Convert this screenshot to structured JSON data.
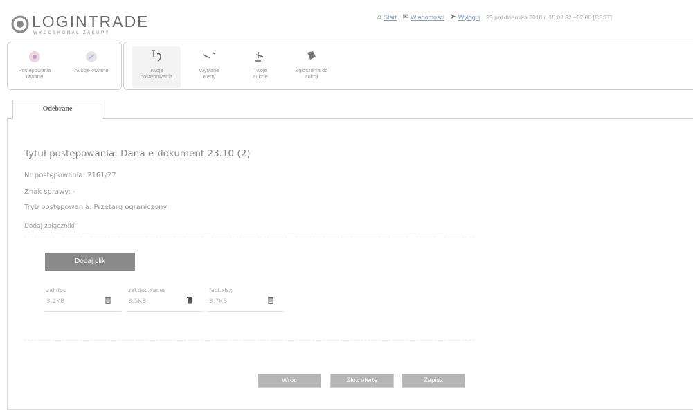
{
  "header": {
    "logo_text": "LOGINTRADE",
    "logo_subtext": "WYDOSKONAL ZAKUPY",
    "nav": [
      {
        "icon": "home-icon",
        "label": "Start"
      },
      {
        "icon": "messages-icon",
        "label": "Wiadomości"
      },
      {
        "icon": "logout-icon",
        "label": "Wyloguj"
      }
    ],
    "timestamp": "25 października 2018 r. 15:02:32 +02:00 [CEST]"
  },
  "toolbar": {
    "group1": [
      {
        "icon": "proceedings-icon",
        "label_line1": "Postępowania",
        "label_line2": "otwarte"
      },
      {
        "icon": "auctions-icon",
        "label_line1": "Aukcje otwarte",
        "label_line2": ""
      }
    ],
    "group2": [
      {
        "icon": "your-proceedings-icon",
        "label_line1": "Twoje",
        "label_line2": "postępowania"
      },
      {
        "icon": "submitted-offers-icon",
        "label_line1": "Wysłane",
        "label_line2": "oferty"
      },
      {
        "icon": "your-auctions-icon",
        "label_line1": "Twoje",
        "label_line2": "aukcje"
      },
      {
        "icon": "auction-entries-icon",
        "label_line1": "Zgłoszenia do",
        "label_line2": "aukcji"
      }
    ]
  },
  "tabs": [
    {
      "label": "Odebrane",
      "active": true
    }
  ],
  "main": {
    "title": "Tytuł postępowania: Dana e-dokument 23.10 (2)",
    "number": "Nr postępowania: 2161/27",
    "case_sign": "Znak sprawy: -",
    "mode": "Tryb postępowania: Przetarg ograniczony",
    "attachments_label": "Dodaj załączniki",
    "add_file_label": "Dodaj plik",
    "files": [
      {
        "name": "zał.doc",
        "size": "3.2KB"
      },
      {
        "name": "zał.doc.xades",
        "size": "3.5KB"
      },
      {
        "name": "fact.xlsx",
        "size": "3.7KB"
      }
    ],
    "buttons": [
      "Wróć",
      "Złóż ofertę",
      "Zapisz"
    ]
  }
}
